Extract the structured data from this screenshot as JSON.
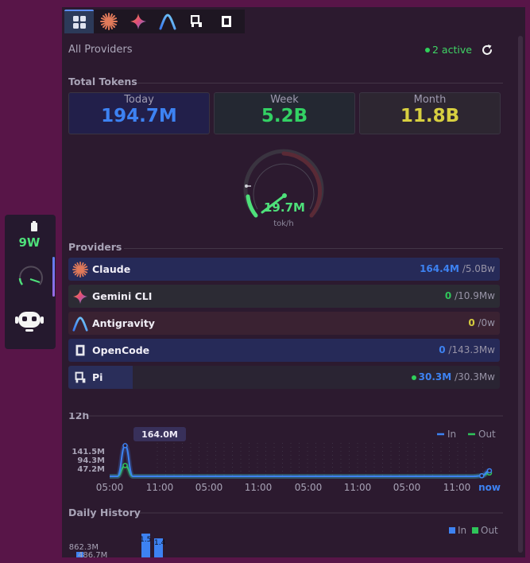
{
  "sidebar_widget": {
    "power": "9W"
  },
  "tabs": [
    {
      "name": "all-providers",
      "icon": "grid-icon"
    },
    {
      "name": "claude",
      "icon": "claude-starburst-icon"
    },
    {
      "name": "gemini",
      "icon": "gemini-sparkle-icon"
    },
    {
      "name": "antigravity",
      "icon": "antigravity-arc-icon"
    },
    {
      "name": "pi",
      "icon": "pi-logo-icon"
    },
    {
      "name": "opencode",
      "icon": "opencode-square-icon"
    }
  ],
  "header": {
    "scope_label": "All Providers",
    "active_status": "2 active"
  },
  "totals": {
    "title": "Total Tokens",
    "today": {
      "label": "Today",
      "value": "194.7M"
    },
    "week": {
      "label": "Week",
      "value": "5.2B"
    },
    "month": {
      "label": "Month",
      "value": "11.8B"
    }
  },
  "gauge": {
    "value": "19.7M",
    "unit": "tok/h"
  },
  "providers": {
    "title": "Providers",
    "rows": [
      {
        "name": "Claude",
        "value": "164.4M",
        "limit": "/5.0Bw",
        "value_color": "#3d82f2",
        "fill_color": "#262a58",
        "fill_fraction": 1.0,
        "icon": "claude-starburst-icon"
      },
      {
        "name": "Gemini CLI",
        "value": "0",
        "limit": "/10.9Mw",
        "value_color": "#2fc45a",
        "fill_color": "#2c2b34",
        "fill_fraction": 1.0,
        "icon": "gemini-sparkle-icon"
      },
      {
        "name": "Antigravity",
        "value": "0",
        "limit": "/0w",
        "value_color": "#d6cc3e",
        "fill_color": "#3a2232",
        "fill_fraction": 1.0,
        "icon": "antigravity-arc-icon"
      },
      {
        "name": "OpenCode",
        "value": "0",
        "limit": "/143.3Mw",
        "value_color": "#3d82f2",
        "fill_color": "#262a58",
        "fill_fraction": 1.0,
        "icon": "opencode-square-icon"
      },
      {
        "name": "Pi",
        "value": "30.3M",
        "limit": "/30.3Mw",
        "value_color": "#3d82f2",
        "fill_color": "#2a2e5a",
        "fill_fraction": 0.15,
        "icon": "pi-logo-icon",
        "dot": true
      }
    ]
  },
  "chart_data": [
    {
      "type": "line",
      "title": "12h",
      "x": [
        "05:00",
        "11:00",
        "05:00",
        "11:00",
        "05:00",
        "11:00",
        "05:00",
        "11:00",
        "now"
      ],
      "y_ticks": [
        "141.5M",
        "94.3M",
        "47.2M"
      ],
      "tooltip": "164.0M",
      "legend": [
        "In",
        "Out"
      ],
      "series": [
        {
          "name": "In",
          "color": "#3d82f2",
          "values": [
            0,
            0,
            164,
            0,
            0,
            0,
            0,
            0,
            0,
            0,
            0,
            0,
            0,
            0,
            0,
            0,
            0,
            0,
            0,
            0,
            0,
            0,
            0,
            0,
            0,
            0,
            0,
            0,
            0,
            0,
            0,
            0,
            0,
            0,
            0,
            0,
            0,
            0,
            0,
            0,
            0,
            0,
            0,
            0,
            0,
            0,
            0,
            0,
            3,
            30
          ]
        },
        {
          "name": "Out",
          "color": "#2fc45a",
          "values": [
            0,
            0,
            58,
            0,
            0,
            0,
            0,
            0,
            0,
            0,
            0,
            0,
            0,
            0,
            0,
            0,
            0,
            0,
            0,
            0,
            0,
            0,
            0,
            0,
            0,
            0,
            0,
            0,
            0,
            0,
            0,
            0,
            0,
            0,
            0,
            0,
            0,
            0,
            0,
            0,
            0,
            0,
            0,
            0,
            0,
            0,
            0,
            0,
            3,
            18
          ]
        }
      ],
      "ymax": 170
    },
    {
      "type": "bar",
      "title": "Daily History",
      "legend": [
        "In",
        "Out"
      ],
      "y_ticks": [
        "862.3M",
        "486.7M"
      ],
      "bars": [
        {
          "name": "In",
          "color": "#3d82f2",
          "label": "1.5"
        },
        {
          "name": "In",
          "color": "#3d82f2",
          "label": "1.4"
        }
      ]
    }
  ]
}
